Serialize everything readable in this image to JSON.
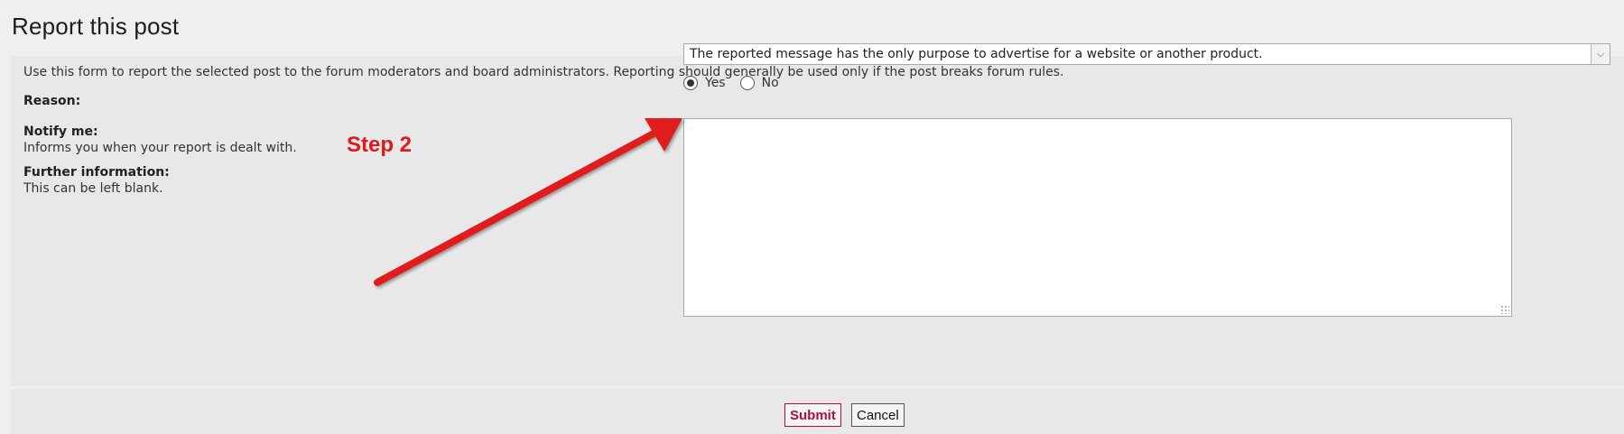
{
  "page": {
    "title": "Report this post"
  },
  "form": {
    "intro": "Use this form to report the selected post to the forum moderators and board administrators. Reporting should generally be used only if the post breaks forum rules.",
    "reason": {
      "label": "Reason:",
      "selected_value": "The reported message has the only purpose to advertise for a website or another product."
    },
    "notify": {
      "label": "Notify me:",
      "hint": "Informs you when your report is dealt with.",
      "options": [
        {
          "label": "Yes",
          "checked": true
        },
        {
          "label": "No",
          "checked": false
        }
      ]
    },
    "further": {
      "label": "Further information:",
      "hint": "This can be left blank.",
      "value": ""
    }
  },
  "actions": {
    "submit_label": "Submit",
    "cancel_label": "Cancel"
  },
  "annotation": {
    "step_label": "Step 2",
    "color": "#e01a1a"
  }
}
